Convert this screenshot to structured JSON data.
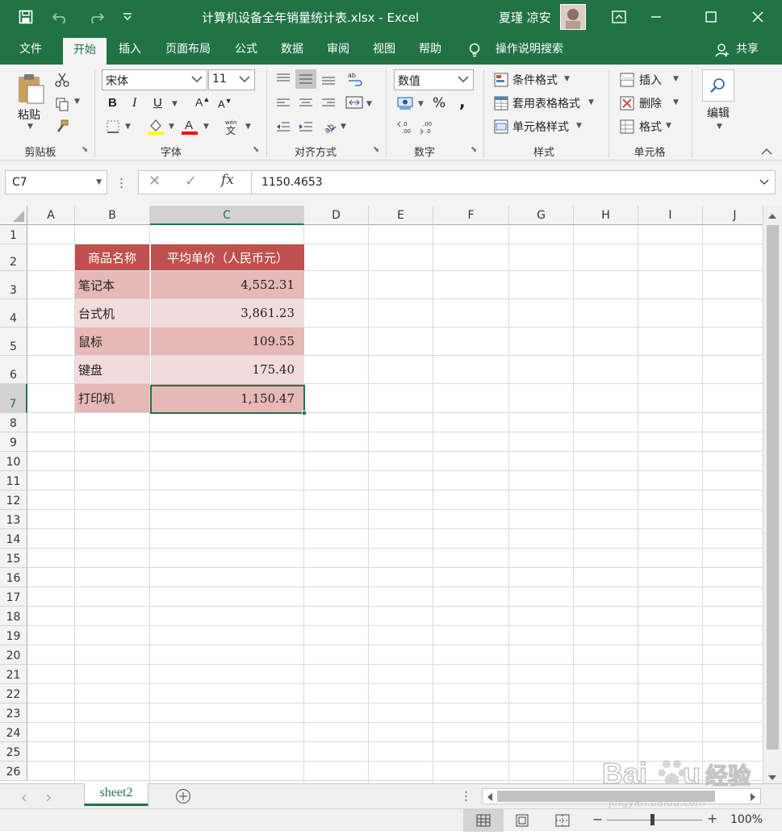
{
  "window": {
    "title": "计算机设备全年销量统计表.xlsx  -  Excel",
    "user": "夏瑾 凉安"
  },
  "tabs": [
    "文件",
    "开始",
    "插入",
    "页面布局",
    "公式",
    "数据",
    "审阅",
    "视图",
    "帮助"
  ],
  "tell_me": "操作说明搜索",
  "share": "共享",
  "ribbon": {
    "clipboard": {
      "paste": "粘贴",
      "label": "剪贴板"
    },
    "font": {
      "name": "宋体",
      "size": "11",
      "label": "字体",
      "bold": "B",
      "italic": "I",
      "underline": "U"
    },
    "alignment": {
      "label": "对齐方式"
    },
    "number": {
      "format": "数值",
      "label": "数字",
      "percent": "%",
      "comma": ","
    },
    "styles": {
      "conditional": "条件格式",
      "table": "套用表格格式",
      "cell": "单元格样式",
      "label": "样式"
    },
    "cells": {
      "insert": "插入",
      "delete": "删除",
      "format": "格式",
      "label": "单元格"
    },
    "editing": {
      "label": "编辑"
    }
  },
  "formula_bar": {
    "name_box": "C7",
    "fx": "fx",
    "value": "1150.4653"
  },
  "columns": [
    "A",
    "B",
    "C",
    "D",
    "E",
    "F",
    "G",
    "H",
    "I",
    "J"
  ],
  "rows": [
    "1",
    "2",
    "3",
    "4",
    "5",
    "6",
    "7",
    "8",
    "9",
    "10",
    "11",
    "12",
    "13",
    "14",
    "15",
    "16",
    "17",
    "18",
    "19",
    "20",
    "21",
    "22",
    "23",
    "24",
    "25",
    "26"
  ],
  "table": {
    "header": [
      "商品名称",
      "平均单价（人民币元）"
    ],
    "rows": [
      [
        "笔记本",
        "4,552.31"
      ],
      [
        "台式机",
        "3,861.23"
      ],
      [
        "鼠标",
        "109.55"
      ],
      [
        "键盘",
        "175.40"
      ],
      [
        "打印机",
        "1,150.47"
      ]
    ]
  },
  "colors": {
    "excel_green": "#217346",
    "header_fill": "#c0504d",
    "band_dark": "#e6b8b7",
    "band_light": "#f2dcdb"
  },
  "sheet_tab": "sheet2",
  "zoom": "100%",
  "watermark": "Baidu经验 jingyan.baidu.com"
}
